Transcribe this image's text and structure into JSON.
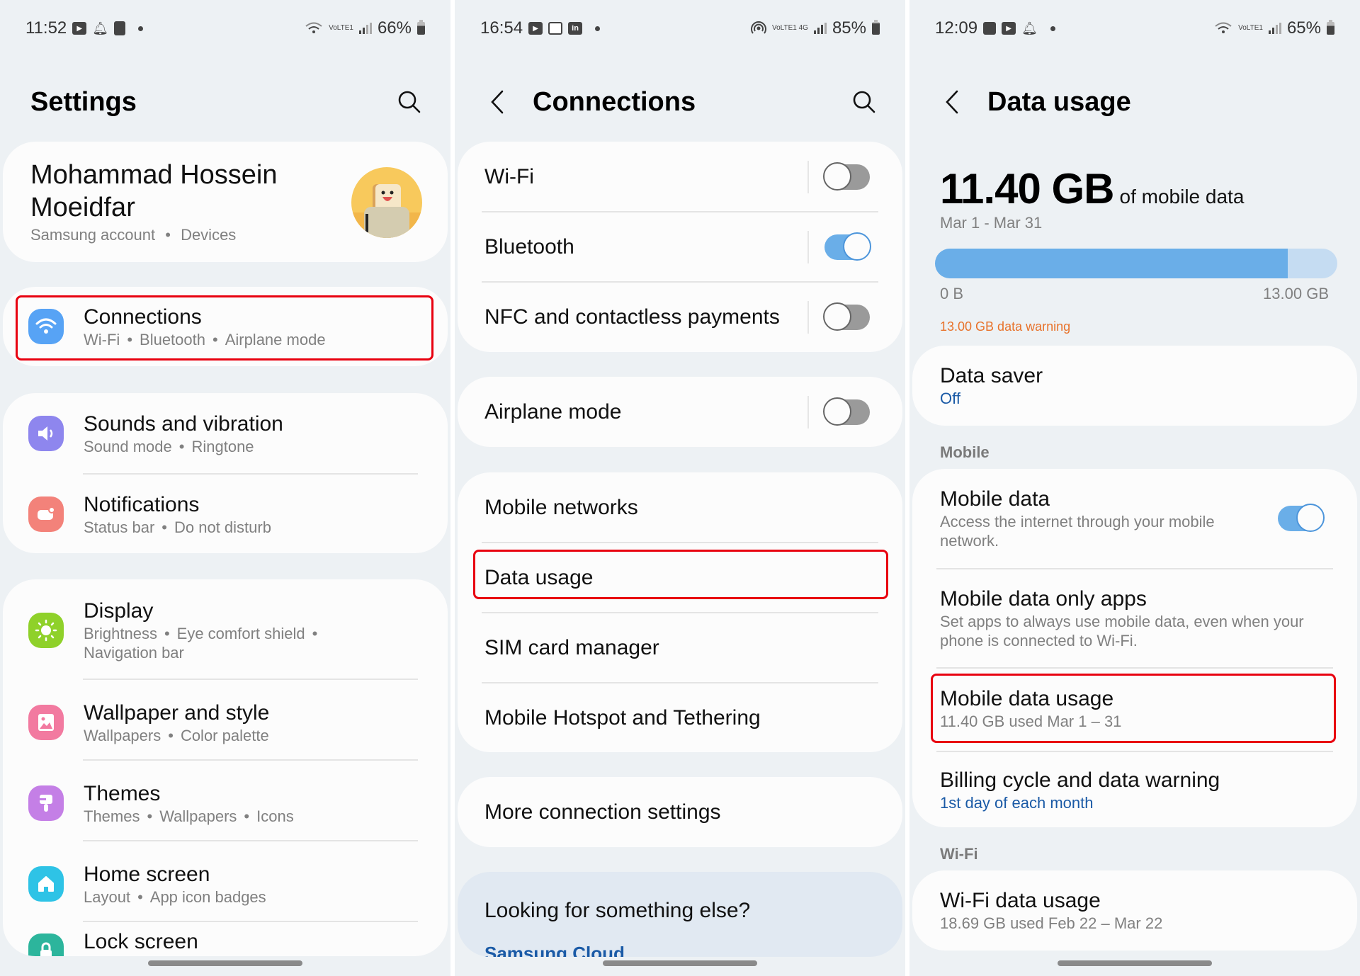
{
  "panels": {
    "settings": {
      "status": {
        "time": "11:52",
        "battery": "66%",
        "network": "VoLTE1"
      },
      "title": "Settings",
      "profile": {
        "name_line1": "Mohammad Hossein",
        "name_line2": "Moeidfar",
        "sub1": "Samsung account",
        "sub2": "Devices"
      },
      "items": [
        {
          "title": "Connections",
          "subs": [
            "Wi-Fi",
            "Bluetooth",
            "Airplane mode"
          ],
          "icon": "wifi-icon",
          "color": "#57a3f5",
          "highlighted": true
        },
        {
          "title": "Sounds and vibration",
          "subs": [
            "Sound mode",
            "Ringtone"
          ],
          "icon": "speaker-icon",
          "color": "#8e86ee"
        },
        {
          "title": "Notifications",
          "subs": [
            "Status bar",
            "Do not disturb"
          ],
          "icon": "notification-icon",
          "color": "#f3827a"
        },
        {
          "title": "Display",
          "subs": [
            "Brightness",
            "Eye comfort shield",
            "Navigation bar"
          ],
          "icon": "sun-icon",
          "color": "#8fd12a"
        },
        {
          "title": "Wallpaper and style",
          "subs": [
            "Wallpapers",
            "Color palette"
          ],
          "icon": "image-icon",
          "color": "#f27aa0"
        },
        {
          "title": "Themes",
          "subs": [
            "Themes",
            "Wallpapers",
            "Icons"
          ],
          "icon": "brush-icon",
          "color": "#c47fe6"
        },
        {
          "title": "Home screen",
          "subs": [
            "Layout",
            "App icon badges"
          ],
          "icon": "home-icon",
          "color": "#2ec3e6"
        },
        {
          "title": "Lock screen",
          "subs": [],
          "icon": "lock-icon",
          "color": "#2cb59c"
        }
      ]
    },
    "connections": {
      "status": {
        "time": "16:54",
        "battery": "85%",
        "network": "VoLTE1 4G"
      },
      "title": "Connections",
      "toggles": [
        {
          "label": "Wi-Fi",
          "on": false
        },
        {
          "label": "Bluetooth",
          "on": true
        },
        {
          "label": "NFC and contactless payments",
          "on": false
        }
      ],
      "airplane": {
        "label": "Airplane mode",
        "on": false
      },
      "menu": [
        {
          "label": "Mobile networks"
        },
        {
          "label": "Data usage",
          "highlighted": true
        },
        {
          "label": "SIM card manager"
        },
        {
          "label": "Mobile Hotspot and Tethering"
        }
      ],
      "more": "More connection settings",
      "looking": {
        "title": "Looking for something else?",
        "link": "Samsung Cloud"
      }
    },
    "data_usage": {
      "status": {
        "time": "12:09",
        "battery": "65%",
        "network": "VoLTE1"
      },
      "title": "Data usage",
      "usage": {
        "amount": "11.40 GB",
        "unit_label": "of mobile data",
        "range": "Mar 1 - Mar 31",
        "used_gb": 11.4,
        "limit_gb": 13.0,
        "min_label": "0 B",
        "max_label": "13.00 GB",
        "warning": "13.00 GB data warning"
      },
      "data_saver": {
        "title": "Data saver",
        "value": "Off"
      },
      "mobile_section": "Mobile",
      "mobile_items": [
        {
          "title": "Mobile data",
          "sub": "Access the internet through your mobile network.",
          "toggle_on": true
        },
        {
          "title": "Mobile data only apps",
          "sub": "Set apps to always use mobile data, even when your phone is connected to Wi-Fi."
        },
        {
          "title": "Mobile data usage",
          "sub": "11.40 GB used Mar 1 – 31",
          "highlighted": true
        },
        {
          "title": "Billing cycle and data warning",
          "sub": "1st day of each month"
        }
      ],
      "wifi_section": "Wi-Fi",
      "wifi_item": {
        "title": "Wi-Fi data usage",
        "sub": "18.69 GB used Feb 22 – Mar 22"
      }
    }
  }
}
